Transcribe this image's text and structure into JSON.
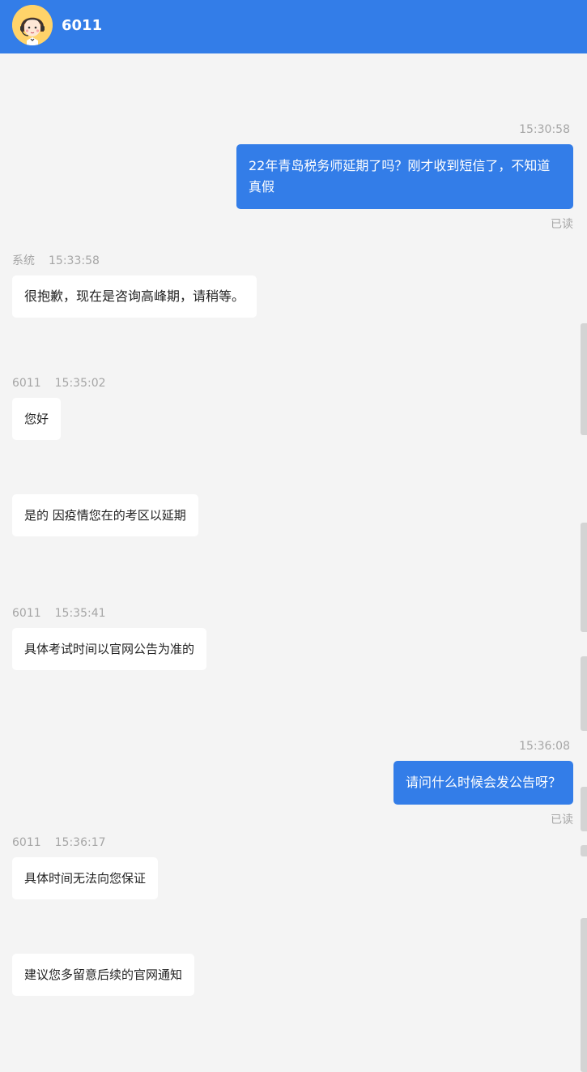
{
  "header": {
    "title": "6011",
    "avatar_icon": "agent-avatar-icon"
  },
  "messages": [
    {
      "direction": "out",
      "time": "15:30:58",
      "text": "22年青岛税务师延期了吗？刚才收到短信了，不知道真假",
      "status": "已读"
    },
    {
      "direction": "in",
      "sender": "系统",
      "time": "15:33:58",
      "text": "很抱歉，现在是咨询高峰期，请稍等。"
    },
    {
      "direction": "in",
      "sender": "6011",
      "time": "15:35:02",
      "text": "您好"
    },
    {
      "direction": "in",
      "text": "是的 因疫情您在的考区以延期"
    },
    {
      "direction": "in",
      "sender": "6011",
      "time": "15:35:41",
      "text": "具体考试时间以官网公告为准的"
    },
    {
      "direction": "out",
      "time": "15:36:08",
      "text": "请问什么时候会发公告呀？",
      "status": "已读"
    },
    {
      "direction": "in",
      "sender": "6011",
      "time": "15:36:17",
      "text": "具体时间无法向您保证"
    },
    {
      "direction": "in",
      "text": "建议您多留意后续的官网通知"
    }
  ],
  "colors": {
    "accent": "#337de8",
    "background": "#f4f4f4",
    "meta_text": "#a6a6a6"
  }
}
